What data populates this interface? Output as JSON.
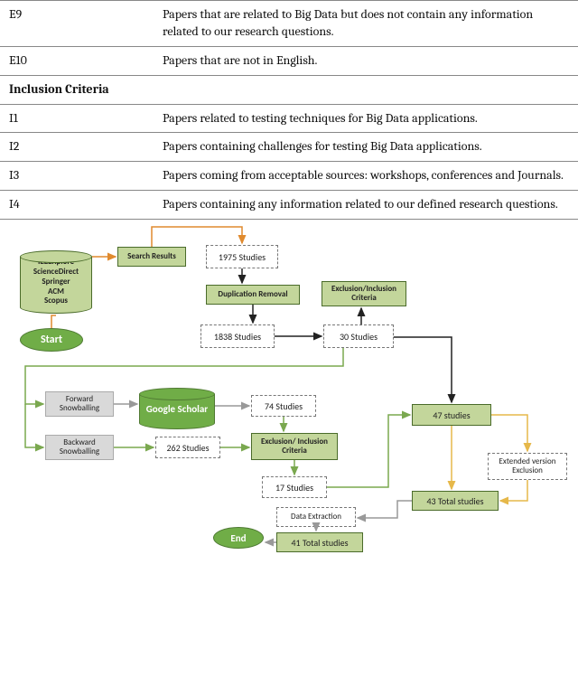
{
  "criteria_rows": [
    {
      "code": "E9",
      "desc": "Papers that are related to Big Data but does not contain any information related to our research questions.",
      "isHeader": false
    },
    {
      "code": "E10",
      "desc": "Papers that are not in English.",
      "isHeader": false
    },
    {
      "code": "Inclusion Criteria",
      "desc": "",
      "isHeader": true
    },
    {
      "code": "I1",
      "desc": "Papers related to testing techniques for Big Data applications.",
      "isHeader": false
    },
    {
      "code": "I2",
      "desc": "Papers containing challenges for testing Big Data applications.",
      "isHeader": false
    },
    {
      "code": "I3",
      "desc": "Papers coming from acceptable sources: workshops, conferences and Journals.",
      "isHeader": false
    },
    {
      "code": "I4",
      "desc": "Papers containing any information related to our defined research questions.",
      "isHeader": false
    }
  ],
  "diagram": {
    "sources_db": "IEEEXplore\nScienceDirect\nSpringer\nACM\nScopus",
    "start": "Start",
    "end": "End",
    "search_results": "Search Results",
    "studies_1975": "1975 Studies",
    "dup_removal": "Duplication Removal",
    "excl_incl": "Exclusion/Inclusion Criteria",
    "studies_1838": "1838 Studies",
    "studies_30": "30 Studies",
    "fwd_snow": "Forward Snowballing",
    "bwd_snow": "Backward Snowballing",
    "google_scholar": "Google Scholar",
    "studies_74": "74 Studies",
    "studies_262": "262 Studies",
    "excl_incl2": "Exclusion/ Inclusion Criteria",
    "studies_17": "17 Studies",
    "studies_47": "47  studies",
    "ext_excl": "Extended version Exclusion",
    "total_43": "43 Total studies",
    "data_extract": "Data Extraction",
    "total_41": "41 Total studies"
  }
}
